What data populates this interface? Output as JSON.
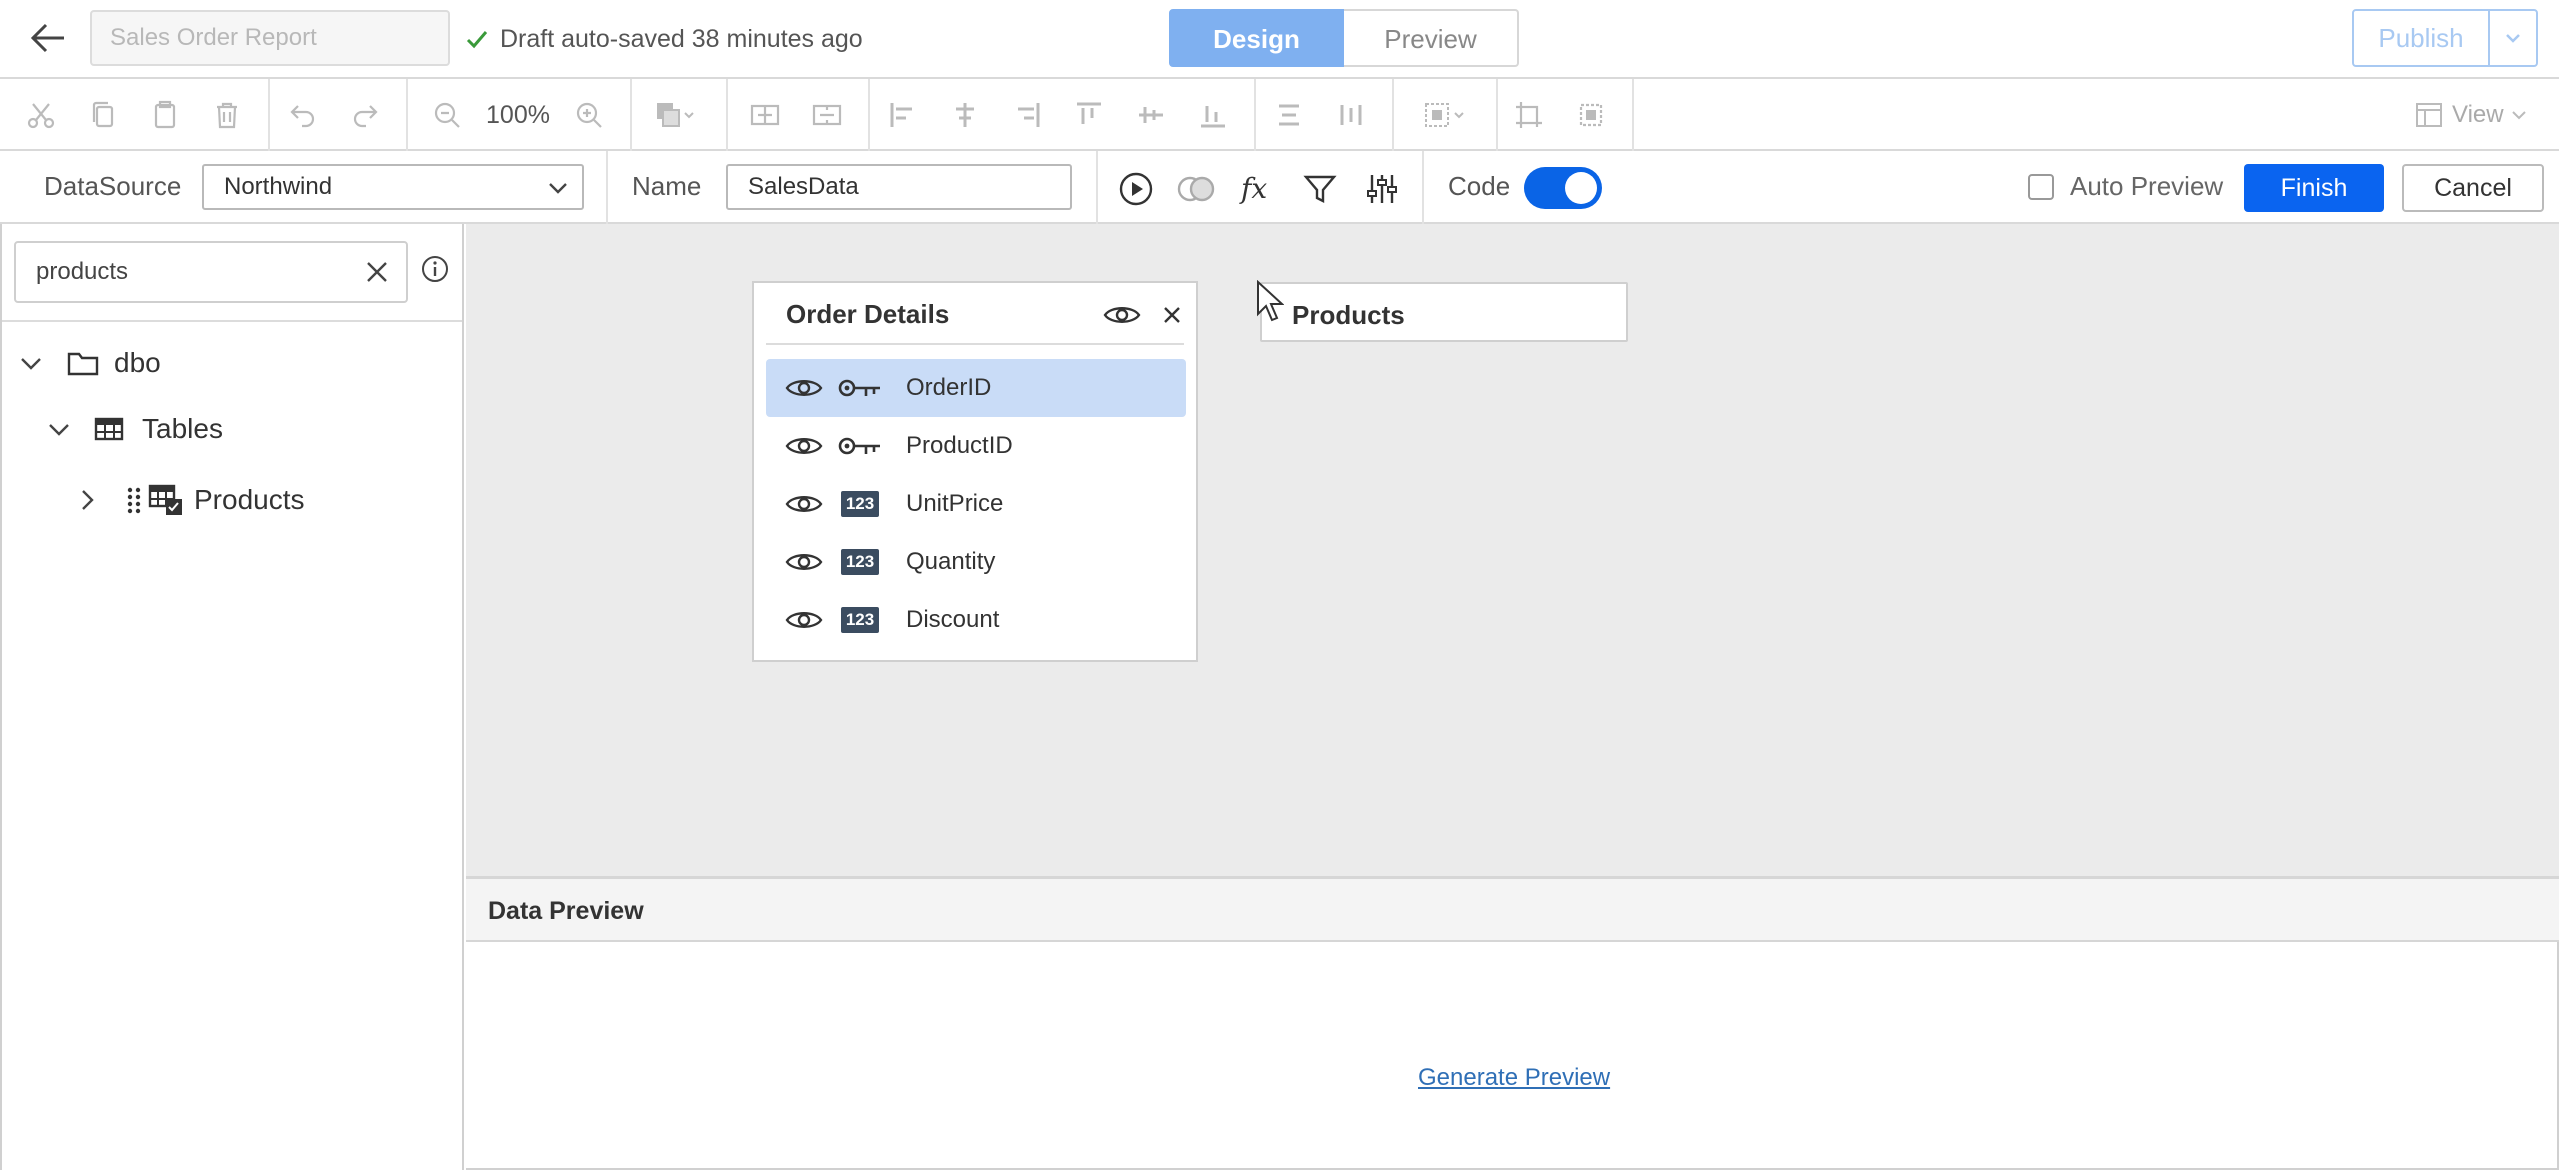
{
  "header": {
    "report_name": "Sales Order Report",
    "saved_status": "Draft auto-saved 38 minutes ago",
    "design_label": "Design",
    "preview_label": "Preview",
    "publish_label": "Publish"
  },
  "toolbar": {
    "zoom": "100%",
    "view_label": "View",
    "icons": [
      "cut-icon",
      "copy-icon",
      "paste-icon",
      "delete-icon",
      "undo-icon",
      "redo-icon",
      "zoom-out-icon",
      "zoom-in-icon",
      "fill-color-icon",
      "split-horizontal-icon",
      "merge-icon",
      "align-left-icon",
      "align-center-icon",
      "align-right-icon",
      "align-top-icon",
      "align-middle-icon",
      "align-bottom-icon",
      "distribute-horizontal-icon",
      "distribute-vertical-icon",
      "group-icon",
      "bring-front-icon",
      "send-back-icon"
    ]
  },
  "querybar": {
    "datasource_label": "DataSource",
    "datasource_value": "Northwind",
    "name_label": "Name",
    "name_value": "SalesData",
    "code_label": "Code",
    "code_on": true,
    "auto_preview_label": "Auto Preview",
    "finish_label": "Finish",
    "cancel_label": "Cancel"
  },
  "left_panel": {
    "search_value": "products",
    "tree": {
      "schema": "dbo",
      "folder": "Tables",
      "table": "Products"
    }
  },
  "canvas": {
    "order_details": {
      "title": "Order Details",
      "fields": [
        {
          "name": "OrderID",
          "type": "key",
          "selected": true
        },
        {
          "name": "ProductID",
          "type": "key",
          "selected": false
        },
        {
          "name": "UnitPrice",
          "type": "number",
          "selected": false
        },
        {
          "name": "Quantity",
          "type": "number",
          "selected": false
        },
        {
          "name": "Discount",
          "type": "number",
          "selected": false
        }
      ],
      "number_badge": "123"
    },
    "products_card_title": "Products"
  },
  "data_preview": {
    "title": "Data Preview",
    "generate_link": "Generate Preview"
  },
  "colors": {
    "primary": "#0a64f0",
    "design_tab": "#7fb0f0",
    "selected_row": "#c9dcf7",
    "canvas_bg": "#ebebeb"
  }
}
